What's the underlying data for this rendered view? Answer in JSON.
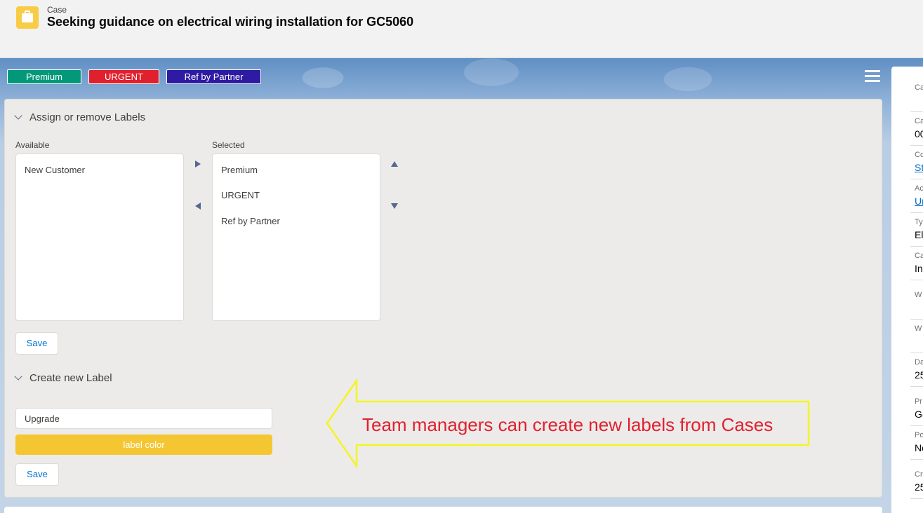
{
  "header": {
    "object_type": "Case",
    "title": "Seeking guidance on electrical wiring installation for GC5060"
  },
  "labels_bar": {
    "badges": [
      {
        "label": "Premium",
        "color": "#04987a"
      },
      {
        "label": "URGENT",
        "color": "#e1202e"
      },
      {
        "label": "Ref by Partner",
        "color": "#2f1ba3"
      }
    ]
  },
  "assign_section": {
    "heading": "Assign or remove Labels",
    "available_label": "Available",
    "selected_label": "Selected",
    "available_items": [
      "New Customer"
    ],
    "selected_items": [
      "Premium",
      "URGENT",
      "Ref by Partner"
    ],
    "save_label": "Save"
  },
  "create_section": {
    "heading": "Create new Label",
    "input_value": "Upgrade",
    "color_button_label": "label color",
    "color_button_color": "#f4c732",
    "save_label": "Save"
  },
  "callout": {
    "text": "Team managers can create new labels from Cases",
    "arrow_color": "#f5f51e",
    "text_color": "#e1202e"
  },
  "side_panel": {
    "fields": [
      {
        "label": "Ca",
        "value": ""
      },
      {
        "label": "Ca",
        "value": "00"
      },
      {
        "label": "Co",
        "value": "St"
      },
      {
        "label": "Ac",
        "value": "Ur"
      },
      {
        "label": "Ty",
        "value": "El"
      },
      {
        "label": "Ca",
        "value": "In"
      },
      {
        "label": "W",
        "value": ""
      },
      {
        "label": "W",
        "value": ""
      },
      {
        "label": "Da",
        "value": "25"
      },
      {
        "label": "Pr",
        "value": "G("
      },
      {
        "label": "Po",
        "value": "Nc"
      },
      {
        "label": "Cr",
        "value": "25"
      }
    ]
  }
}
